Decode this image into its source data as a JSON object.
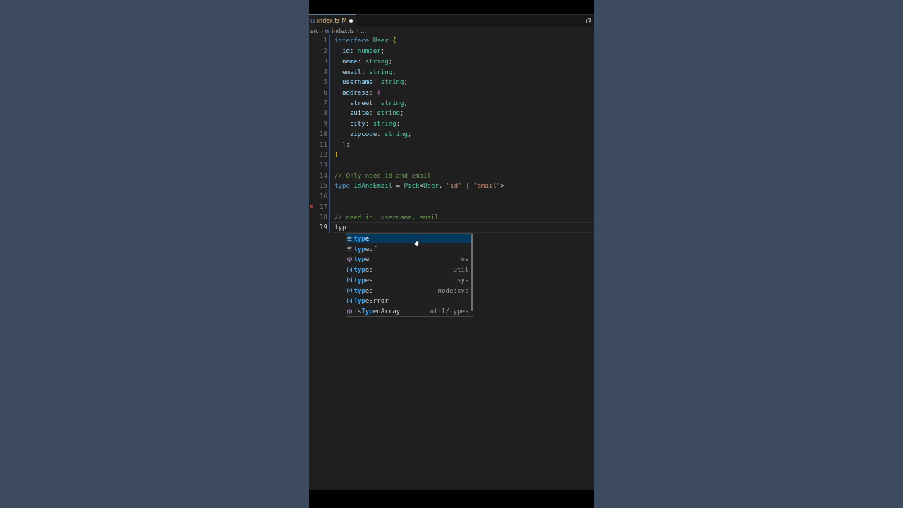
{
  "tab": {
    "badge": "ts",
    "name": "index.ts",
    "status": "M",
    "dirty": true,
    "selected": true
  },
  "breadcrumb": [
    {
      "kind": "folder",
      "label": "src"
    },
    {
      "kind": "file",
      "badge": "ts",
      "label": "index.ts"
    },
    {
      "kind": "more",
      "label": "…"
    }
  ],
  "editor": {
    "lines": [
      {
        "number": "1",
        "modified": true,
        "breakpoint": false,
        "current": false,
        "tokens": [
          {
            "text": "interface ",
            "kind": "keyword"
          },
          {
            "text": "User ",
            "kind": "type"
          },
          {
            "text": "{",
            "kind": "bracket1"
          }
        ]
      },
      {
        "number": "2",
        "modified": true,
        "breakpoint": false,
        "current": false,
        "tokens": [
          {
            "text": "  id",
            "kind": "property"
          },
          {
            "text": ": ",
            "kind": "punct"
          },
          {
            "text": "number",
            "kind": "type"
          },
          {
            "text": ";",
            "kind": "punct"
          }
        ]
      },
      {
        "number": "3",
        "modified": true,
        "breakpoint": false,
        "current": false,
        "tokens": [
          {
            "text": "  name",
            "kind": "property"
          },
          {
            "text": ": ",
            "kind": "punct"
          },
          {
            "text": "string",
            "kind": "type"
          },
          {
            "text": ";",
            "kind": "punct"
          }
        ]
      },
      {
        "number": "4",
        "modified": true,
        "breakpoint": false,
        "current": false,
        "tokens": [
          {
            "text": "  email",
            "kind": "property"
          },
          {
            "text": ": ",
            "kind": "punct"
          },
          {
            "text": "string",
            "kind": "type"
          },
          {
            "text": ";",
            "kind": "punct"
          }
        ]
      },
      {
        "number": "5",
        "modified": true,
        "breakpoint": false,
        "current": false,
        "tokens": [
          {
            "text": "  username",
            "kind": "property"
          },
          {
            "text": ": ",
            "kind": "punct"
          },
          {
            "text": "string",
            "kind": "type"
          },
          {
            "text": ";",
            "kind": "punct"
          }
        ]
      },
      {
        "number": "6",
        "modified": true,
        "breakpoint": false,
        "current": false,
        "tokens": [
          {
            "text": "  address",
            "kind": "property"
          },
          {
            "text": ": ",
            "kind": "punct"
          },
          {
            "text": "{",
            "kind": "bracket2"
          }
        ]
      },
      {
        "number": "7",
        "modified": true,
        "breakpoint": false,
        "current": false,
        "tokens": [
          {
            "text": "    street",
            "kind": "property"
          },
          {
            "text": ": ",
            "kind": "punct"
          },
          {
            "text": "string",
            "kind": "type"
          },
          {
            "text": ";",
            "kind": "punct"
          }
        ]
      },
      {
        "number": "8",
        "modified": true,
        "breakpoint": false,
        "current": false,
        "tokens": [
          {
            "text": "    suite",
            "kind": "property"
          },
          {
            "text": ": ",
            "kind": "punct"
          },
          {
            "text": "string",
            "kind": "type"
          },
          {
            "text": ";",
            "kind": "punct"
          }
        ]
      },
      {
        "number": "9",
        "modified": true,
        "breakpoint": false,
        "current": false,
        "tokens": [
          {
            "text": "    city",
            "kind": "property"
          },
          {
            "text": ": ",
            "kind": "punct"
          },
          {
            "text": "string",
            "kind": "type"
          },
          {
            "text": ";",
            "kind": "punct"
          }
        ]
      },
      {
        "number": "10",
        "modified": true,
        "breakpoint": false,
        "current": false,
        "tokens": [
          {
            "text": "    zipcode",
            "kind": "property"
          },
          {
            "text": ": ",
            "kind": "punct"
          },
          {
            "text": "string",
            "kind": "type"
          },
          {
            "text": ";",
            "kind": "punct"
          }
        ]
      },
      {
        "number": "11",
        "modified": true,
        "breakpoint": false,
        "current": false,
        "tokens": [
          {
            "text": "  }",
            "kind": "bracket2"
          },
          {
            "text": ";",
            "kind": "punct"
          }
        ]
      },
      {
        "number": "12",
        "modified": true,
        "breakpoint": false,
        "current": false,
        "tokens": [
          {
            "text": "}",
            "kind": "bracket1"
          }
        ]
      },
      {
        "number": "13",
        "modified": true,
        "breakpoint": false,
        "current": false
      },
      {
        "number": "14",
        "modified": true,
        "breakpoint": false,
        "current": false,
        "tokens": [
          {
            "text": "// Only need id and email",
            "kind": "comment"
          }
        ]
      },
      {
        "number": "15",
        "modified": true,
        "breakpoint": false,
        "current": false,
        "tokens": [
          {
            "text": "type ",
            "kind": "keyword"
          },
          {
            "text": "IdAndEmail ",
            "kind": "type"
          },
          {
            "text": "= ",
            "kind": "punct"
          },
          {
            "text": "Pick",
            "kind": "type"
          },
          {
            "text": "<",
            "kind": "punct"
          },
          {
            "text": "User",
            "kind": "type"
          },
          {
            "text": ", ",
            "kind": "punct"
          },
          {
            "text": "\"id\"",
            "kind": "string"
          },
          {
            "text": " | ",
            "kind": "punct"
          },
          {
            "text": "\"email\"",
            "kind": "string"
          },
          {
            "text": ">",
            "kind": "punct"
          }
        ]
      },
      {
        "number": "16",
        "modified": true,
        "breakpoint": false,
        "current": false
      },
      {
        "number": "17",
        "modified": true,
        "breakpoint": true,
        "current": false
      },
      {
        "number": "18",
        "modified": true,
        "breakpoint": false,
        "current": false,
        "tokens": [
          {
            "text": "// need id, username, email",
            "kind": "comment"
          }
        ]
      },
      {
        "number": "19",
        "modified": true,
        "breakpoint": false,
        "current": true,
        "tokens": [
          {
            "text": "typ",
            "kind": "plain"
          }
        ]
      }
    ]
  },
  "suggestions": [
    {
      "kind": "keyword",
      "parts": [
        {
          "text": "typ",
          "matched": true
        },
        {
          "text": "e",
          "matched": false
        }
      ],
      "selected": true
    },
    {
      "kind": "keyword",
      "parts": [
        {
          "text": "typ",
          "matched": true
        },
        {
          "text": "eof",
          "matched": false
        }
      ],
      "selected": false
    },
    {
      "kind": "function",
      "parts": [
        {
          "text": "typ",
          "matched": true
        },
        {
          "text": "e",
          "matched": false
        }
      ],
      "detail": "os",
      "selected": false
    },
    {
      "kind": "variable",
      "parts": [
        {
          "text": "typ",
          "matched": true
        },
        {
          "text": "es",
          "matched": false
        }
      ],
      "detail": "util",
      "selected": false
    },
    {
      "kind": "variable",
      "parts": [
        {
          "text": "typ",
          "matched": true
        },
        {
          "text": "es",
          "matched": false
        }
      ],
      "detail": "sys",
      "selected": false
    },
    {
      "kind": "variable",
      "parts": [
        {
          "text": "typ",
          "matched": true
        },
        {
          "text": "es",
          "matched": false
        }
      ],
      "detail": "node:sys",
      "selected": false
    },
    {
      "kind": "variable",
      "parts": [
        {
          "text": "Typ",
          "matched": true
        },
        {
          "text": "eError",
          "matched": false
        }
      ],
      "selected": false
    },
    {
      "kind": "function",
      "parts": [
        {
          "text": "is",
          "matched": false
        },
        {
          "text": "Typ",
          "matched": true
        },
        {
          "text": "edArray",
          "matched": false
        }
      ],
      "detail": "util/types",
      "selected": false
    }
  ]
}
